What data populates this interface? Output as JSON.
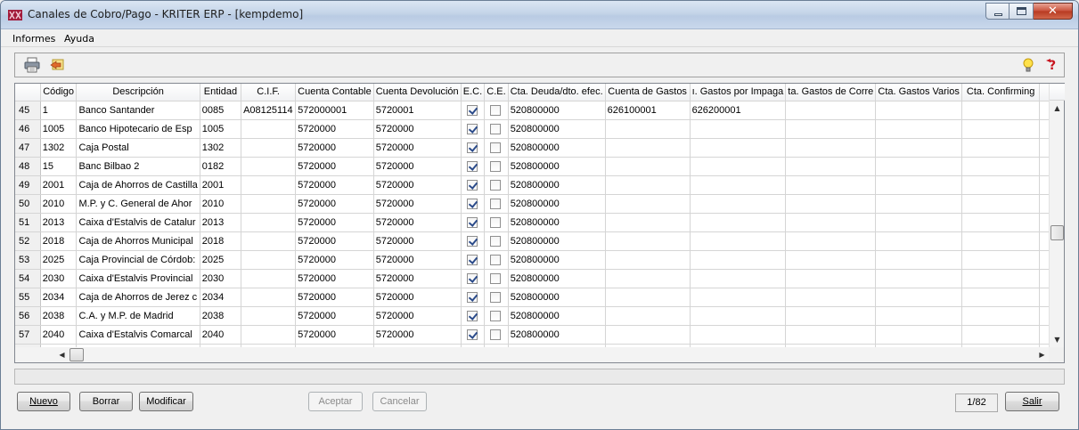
{
  "window": {
    "title": "Canales de Cobro/Pago - KRITER ERP - [kempdemo]",
    "minimize": "minimize",
    "maximize": "maximize",
    "close": "✕"
  },
  "menu": [
    {
      "label": "Informes"
    },
    {
      "label": "Ayuda"
    }
  ],
  "toolbar": {
    "print_icon": "printer-icon",
    "export_icon": "export-icon",
    "tip_icon": "lightbulb-icon",
    "help_icon": "help-icon"
  },
  "grid": {
    "columns": [
      "",
      "Código",
      "Descripción",
      "Entidad",
      "C.I.F.",
      "Cuenta Contable",
      "Cuenta Devolución",
      "E.C.",
      "C.E.",
      "Cta. Deuda/dto. efec.",
      "Cuenta de Gastos",
      "ı. Gastos por Impaga",
      "ta. Gastos de Corre",
      "Cta. Gastos Varios",
      "Cta. Confirming"
    ],
    "rows": [
      {
        "n": "45",
        "codigo": "1",
        "desc": "Banco Santander",
        "entidad": "0085",
        "cif": "A08125114",
        "contable": "572000001",
        "devolucion": "5720001",
        "ec": true,
        "ce": false,
        "deuda": "520800000",
        "gastos": "626100001",
        "impag": "626200001"
      },
      {
        "n": "46",
        "codigo": "1005",
        "desc": "Banco Hipotecario de Esp",
        "entidad": "1005",
        "cif": "",
        "contable": "5720000",
        "devolucion": "5720000",
        "ec": true,
        "ce": false,
        "deuda": "520800000",
        "gastos": "",
        "impag": ""
      },
      {
        "n": "47",
        "codigo": "1302",
        "desc": "Caja Postal",
        "entidad": "1302",
        "cif": "",
        "contable": "5720000",
        "devolucion": "5720000",
        "ec": true,
        "ce": false,
        "deuda": "520800000",
        "gastos": "",
        "impag": ""
      },
      {
        "n": "48",
        "codigo": "15",
        "desc": "Banc Bilbao 2",
        "entidad": "0182",
        "cif": "",
        "contable": "5720000",
        "devolucion": "5720000",
        "ec": true,
        "ce": false,
        "deuda": "520800000",
        "gastos": "",
        "impag": ""
      },
      {
        "n": "49",
        "codigo": "2001",
        "desc": "Caja de Ahorros de Castilla",
        "entidad": "2001",
        "cif": "",
        "contable": "5720000",
        "devolucion": "5720000",
        "ec": true,
        "ce": false,
        "deuda": "520800000",
        "gastos": "",
        "impag": ""
      },
      {
        "n": "50",
        "codigo": "2010",
        "desc": "M.P. y C. General de Ahor",
        "entidad": "2010",
        "cif": "",
        "contable": "5720000",
        "devolucion": "5720000",
        "ec": true,
        "ce": false,
        "deuda": "520800000",
        "gastos": "",
        "impag": ""
      },
      {
        "n": "51",
        "codigo": "2013",
        "desc": "Caixa d'Estalvis de Catalur",
        "entidad": "2013",
        "cif": "",
        "contable": "5720000",
        "devolucion": "5720000",
        "ec": true,
        "ce": false,
        "deuda": "520800000",
        "gastos": "",
        "impag": ""
      },
      {
        "n": "52",
        "codigo": "2018",
        "desc": "Caja de Ahorros Municipal",
        "entidad": "2018",
        "cif": "",
        "contable": "5720000",
        "devolucion": "5720000",
        "ec": true,
        "ce": false,
        "deuda": "520800000",
        "gastos": "",
        "impag": ""
      },
      {
        "n": "53",
        "codigo": "2025",
        "desc": "Caja Provincial de Córdob:",
        "entidad": "2025",
        "cif": "",
        "contable": "5720000",
        "devolucion": "5720000",
        "ec": true,
        "ce": false,
        "deuda": "520800000",
        "gastos": "",
        "impag": ""
      },
      {
        "n": "54",
        "codigo": "2030",
        "desc": "Caixa d'Estalvis Provincial",
        "entidad": "2030",
        "cif": "",
        "contable": "5720000",
        "devolucion": "5720000",
        "ec": true,
        "ce": false,
        "deuda": "520800000",
        "gastos": "",
        "impag": ""
      },
      {
        "n": "55",
        "codigo": "2034",
        "desc": "Caja de Ahorros de Jerez c",
        "entidad": "2034",
        "cif": "",
        "contable": "5720000",
        "devolucion": "5720000",
        "ec": true,
        "ce": false,
        "deuda": "520800000",
        "gastos": "",
        "impag": ""
      },
      {
        "n": "56",
        "codigo": "2038",
        "desc": "C.A. y M.P. de Madrid",
        "entidad": "2038",
        "cif": "",
        "contable": "5720000",
        "devolucion": "5720000",
        "ec": true,
        "ce": false,
        "deuda": "520800000",
        "gastos": "",
        "impag": ""
      },
      {
        "n": "57",
        "codigo": "2040",
        "desc": "Caixa d'Estalvis Comarcal",
        "entidad": "2040",
        "cif": "",
        "contable": "5720000",
        "devolucion": "5720000",
        "ec": true,
        "ce": false,
        "deuda": "520800000",
        "gastos": "",
        "impag": ""
      }
    ]
  },
  "buttons": {
    "nuevo": "Nuevo",
    "borrar": "Borrar",
    "modificar": "Modificar",
    "aceptar": "Aceptar",
    "cancelar": "Cancelar",
    "salir": "Salir"
  },
  "record_counter": "1/82",
  "colors": {
    "accent": "#2b4b8a",
    "close_button": "#c9503a"
  }
}
